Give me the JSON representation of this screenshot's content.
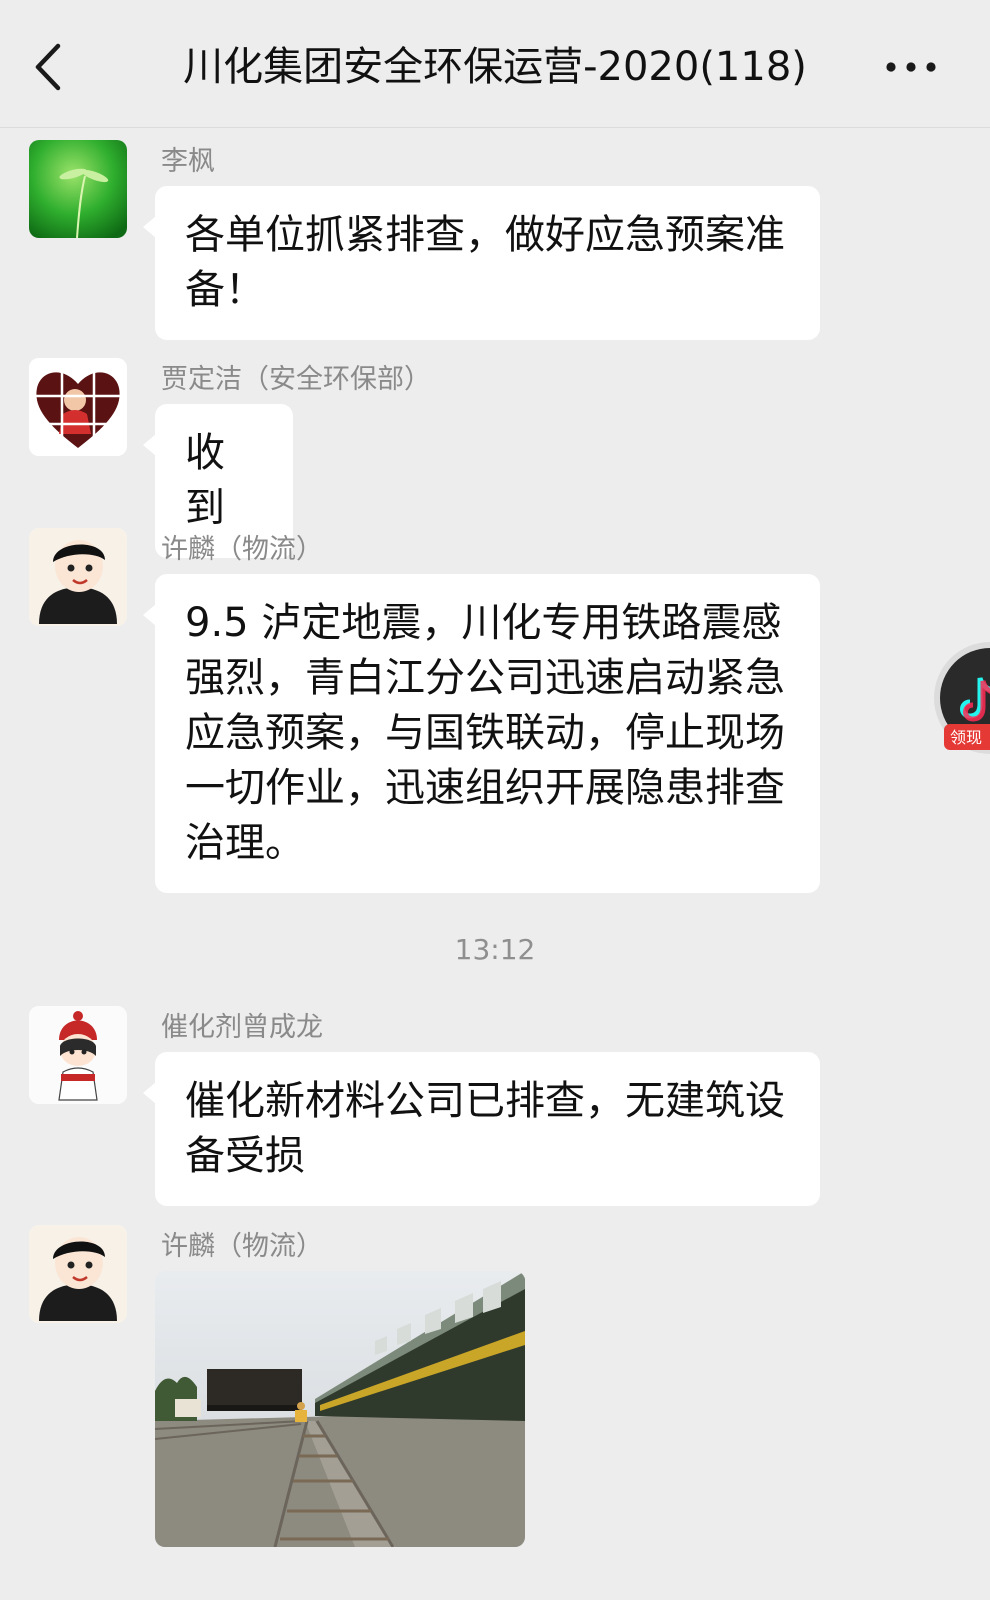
{
  "header": {
    "title": "川化集团安全环保运营-2020(118)"
  },
  "messages": [
    {
      "sender": "李枫",
      "lines": [
        "各单位抓紧排查，做好应急预案准",
        "备！"
      ]
    },
    {
      "sender": "贾定洁（安全环保部）",
      "lines": [
        "收到"
      ]
    },
    {
      "sender": "许麟（物流）",
      "lines": [
        "9.5 泸定地震，川化专用铁路震感",
        "强烈，青白江分公司迅速启动紧急",
        "应急预案，与国铁联动，停止现场",
        "一切作业，迅速组织开展隐患排查",
        "治理。"
      ]
    },
    {
      "sender": "催化剂曾成龙",
      "lines": [
        "催化新材料公司已排查，无建筑设",
        "备受损"
      ]
    },
    {
      "sender": "许麟（物流）",
      "image": "railway-inspection-photo"
    }
  ],
  "timestamp": "13:12",
  "floating_widget": {
    "label": "领现",
    "icon": "tiktok-icon"
  },
  "colors": {
    "background": "#ededed",
    "bubble": "#ffffff",
    "sender_text": "#8a8a8a",
    "timestamp_text": "#8f8f8f"
  }
}
